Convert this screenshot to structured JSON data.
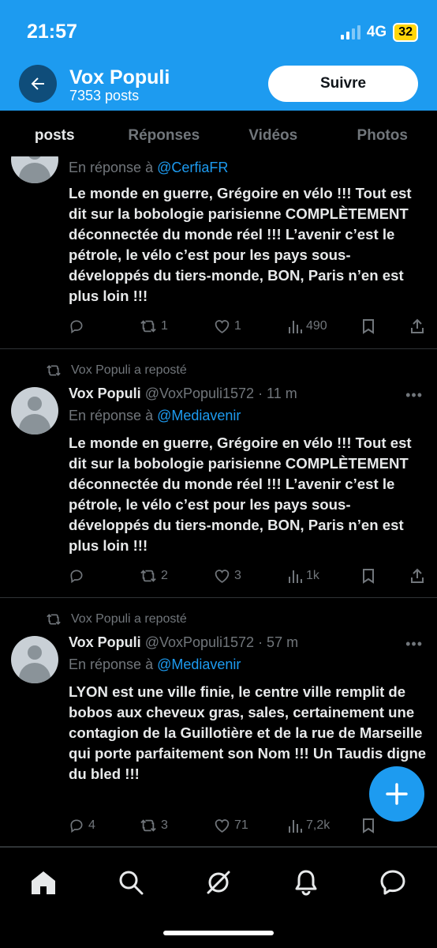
{
  "status_bar": {
    "time": "21:57",
    "network": "4G",
    "battery": "32"
  },
  "header": {
    "name": "Vox Populi",
    "posts_count": "7353 posts",
    "follow_label": "Suivre"
  },
  "tabs": [
    {
      "label": "posts",
      "active": true
    },
    {
      "label": "Réponses",
      "active": false
    },
    {
      "label": "Vidéos",
      "active": false
    },
    {
      "label": "Photos",
      "active": false
    }
  ],
  "tweets": [
    {
      "reply_prefix": "En réponse à",
      "reply_mention": "@CerfiaFR",
      "text": "Le monde en guerre, Grégoire en vélo !!! Tout est dit sur la bobologie parisienne COMPLÈTEMENT déconnectée du monde réel !!! L’avenir c’est le pétrole, le vélo c’est pour les pays sous-développés du tiers-monde, BON, Paris n’en est plus loin !!!",
      "replies": "",
      "reposts": "1",
      "likes": "1",
      "views": "490"
    },
    {
      "reposted_by": "Vox Populi a reposté",
      "name": "Vox Populi",
      "handle_time": "@VoxPopuli1572 · 11 m",
      "reply_prefix": "En réponse à",
      "reply_mention": "@Mediavenir",
      "text": "Le monde en guerre, Grégoire en vélo !!! Tout est dit sur la bobologie parisienne COMPLÈTEMENT déconnectée du monde réel !!! L’avenir c’est le pétrole, le vélo c’est pour les pays sous-développés du tiers-monde, BON, Paris n’en est plus loin !!!",
      "replies": "",
      "reposts": "2",
      "likes": "3",
      "views": "1k"
    },
    {
      "reposted_by": "Vox Populi a reposté",
      "name": "Vox Populi",
      "handle_time": "@VoxPopuli1572 · 57 m",
      "reply_prefix": "En réponse à",
      "reply_mention": "@Mediavenir",
      "text": "LYON est une ville finie, le centre ville remplit de bobos aux cheveux gras, sales, certainement une contagion de la Guillotière et de la rue de Marseille qui porte parfaitement son Nom !!! Un Taudis digne du bled !!!",
      "replies": "4",
      "reposts": "3",
      "likes": "71",
      "views": "7,2k"
    }
  ],
  "more_label": "•••",
  "icons": {
    "back": "arrow-left-icon",
    "compose": "plus-icon",
    "nav": [
      "home-icon",
      "search-icon",
      "grok-icon",
      "bell-icon",
      "messages-icon"
    ]
  },
  "colors": {
    "accent": "#1d9bf0",
    "background": "#000000",
    "muted": "#71767b"
  }
}
